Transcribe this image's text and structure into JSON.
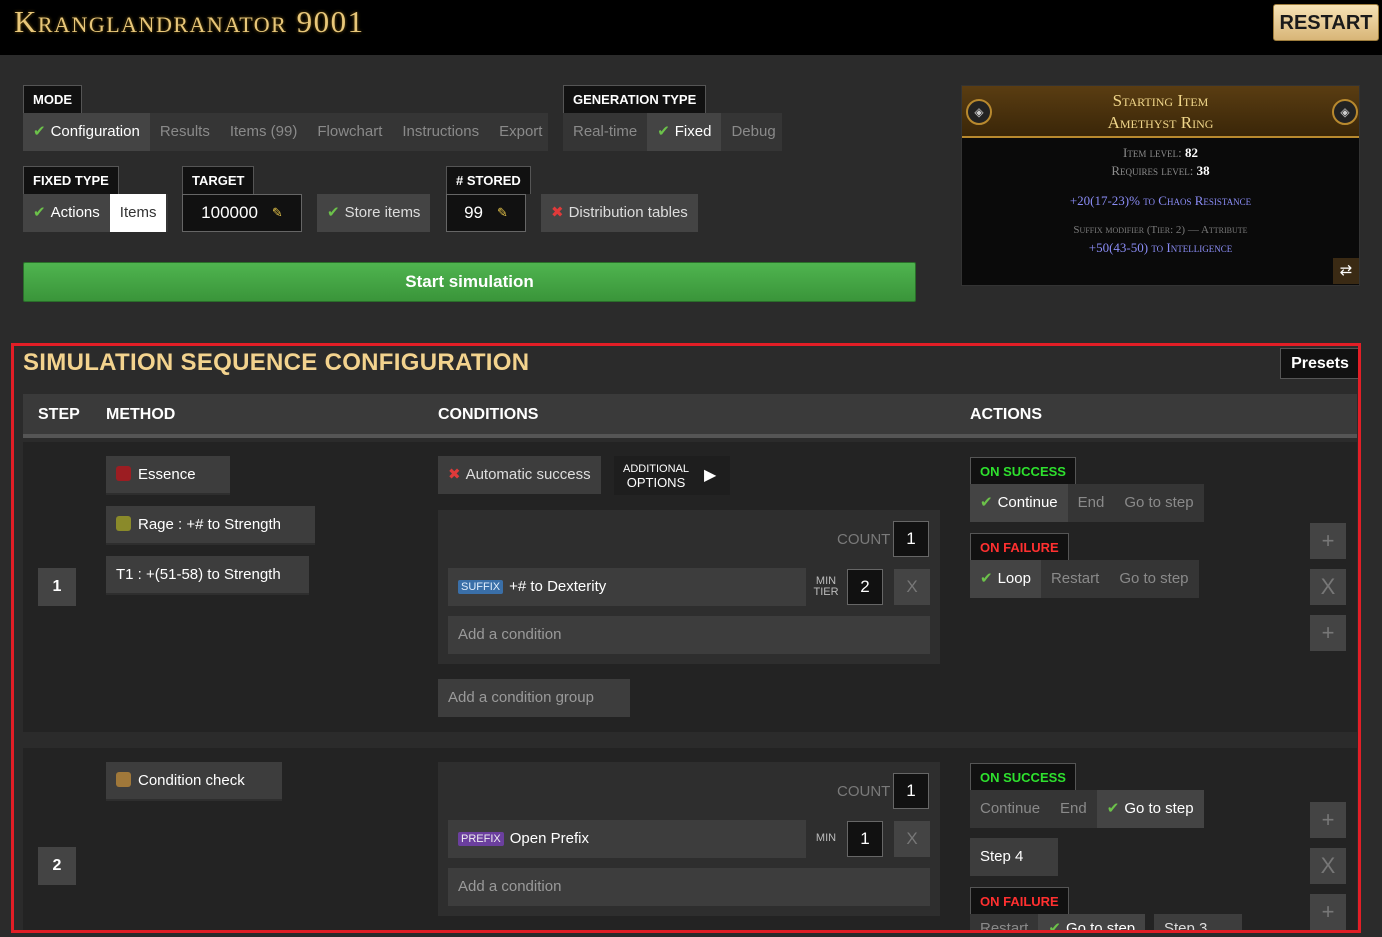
{
  "header": {
    "title": "Kranglandranator 9001",
    "restart": "RESTART"
  },
  "mode": {
    "label": "MODE",
    "tabs": [
      "Configuration",
      "Results",
      "Items (99)",
      "Flowchart",
      "Instructions",
      "Export"
    ],
    "selected": "Configuration"
  },
  "generation": {
    "label": "GENERATION TYPE",
    "tabs": [
      "Real-time",
      "Fixed",
      "Debug"
    ],
    "selected": "Fixed"
  },
  "fixed_type": {
    "label": "FIXED TYPE",
    "tabs": [
      "Actions",
      "Items"
    ],
    "selected": "Actions"
  },
  "target": {
    "label": "TARGET",
    "value": "100000"
  },
  "store_items": {
    "label": "Store items",
    "checked": true
  },
  "stored": {
    "label": "# STORED",
    "value": "99"
  },
  "distribution": {
    "label": "Distribution tables",
    "checked": false
  },
  "start_button": "Start simulation",
  "item": {
    "header_line1": "Starting Item",
    "header_line2": "Amethyst Ring",
    "item_level_label": "Item level:",
    "item_level": "82",
    "req_level_label": "Requires level:",
    "req_level": "38",
    "implicit": "+20(17-23)% to Chaos Resistance",
    "mod_header": "Suffix modifier (Tier: 2) — Attribute",
    "mod_text": "+50(43-50) to Intelligence"
  },
  "sequence": {
    "title": "SIMULATION SEQUENCE CONFIGURATION",
    "presets": "Presets",
    "headers": {
      "step": "STEP",
      "method": "METHOD",
      "conditions": "CONDITIONS",
      "actions": "ACTIONS"
    },
    "steps": [
      {
        "number": "1",
        "methods": [
          "Essence",
          "Rage : +# to Strength",
          "T1 : +(51-58) to Strength"
        ],
        "auto_success": "Automatic success",
        "additional_options": {
          "line1": "ADDITIONAL",
          "line2": "OPTIONS"
        },
        "count_label": "COUNT",
        "count": "1",
        "condition": {
          "badge": "SUFFIX",
          "text": "+# to Dexterity",
          "tier_label_1": "MIN",
          "tier_label_2": "TIER",
          "tier": "2",
          "remove": "X"
        },
        "add_condition": "Add a condition",
        "add_group": "Add a condition group",
        "on_success": {
          "label": "ON SUCCESS",
          "options": [
            "Continue",
            "End",
            "Go to step"
          ],
          "selected": "Continue"
        },
        "on_failure": {
          "label": "ON FAILURE",
          "options": [
            "Loop",
            "Restart",
            "Go to step"
          ],
          "selected": "Loop"
        },
        "side": [
          "+",
          "X",
          "+"
        ]
      },
      {
        "number": "2",
        "methods": [
          "Condition check"
        ],
        "count_label": "COUNT",
        "count": "1",
        "condition": {
          "badge": "PREFIX",
          "text": "Open Prefix",
          "min_label": "MIN",
          "min": "1",
          "remove": "X"
        },
        "add_condition": "Add a condition",
        "on_success": {
          "label": "ON SUCCESS",
          "options": [
            "Continue",
            "End",
            "Go to step"
          ],
          "selected": "Go to step"
        },
        "goto": "Step 4",
        "on_failure": {
          "label": "ON FAILURE",
          "options": [
            "Restart",
            "Go to step",
            "Step 3"
          ]
        },
        "side": [
          "+",
          "X",
          "+"
        ]
      }
    ]
  },
  "colors": {
    "accent_gold": "#f3d38e",
    "green": "#4fb44f",
    "highlight_red": "#e21e26"
  }
}
